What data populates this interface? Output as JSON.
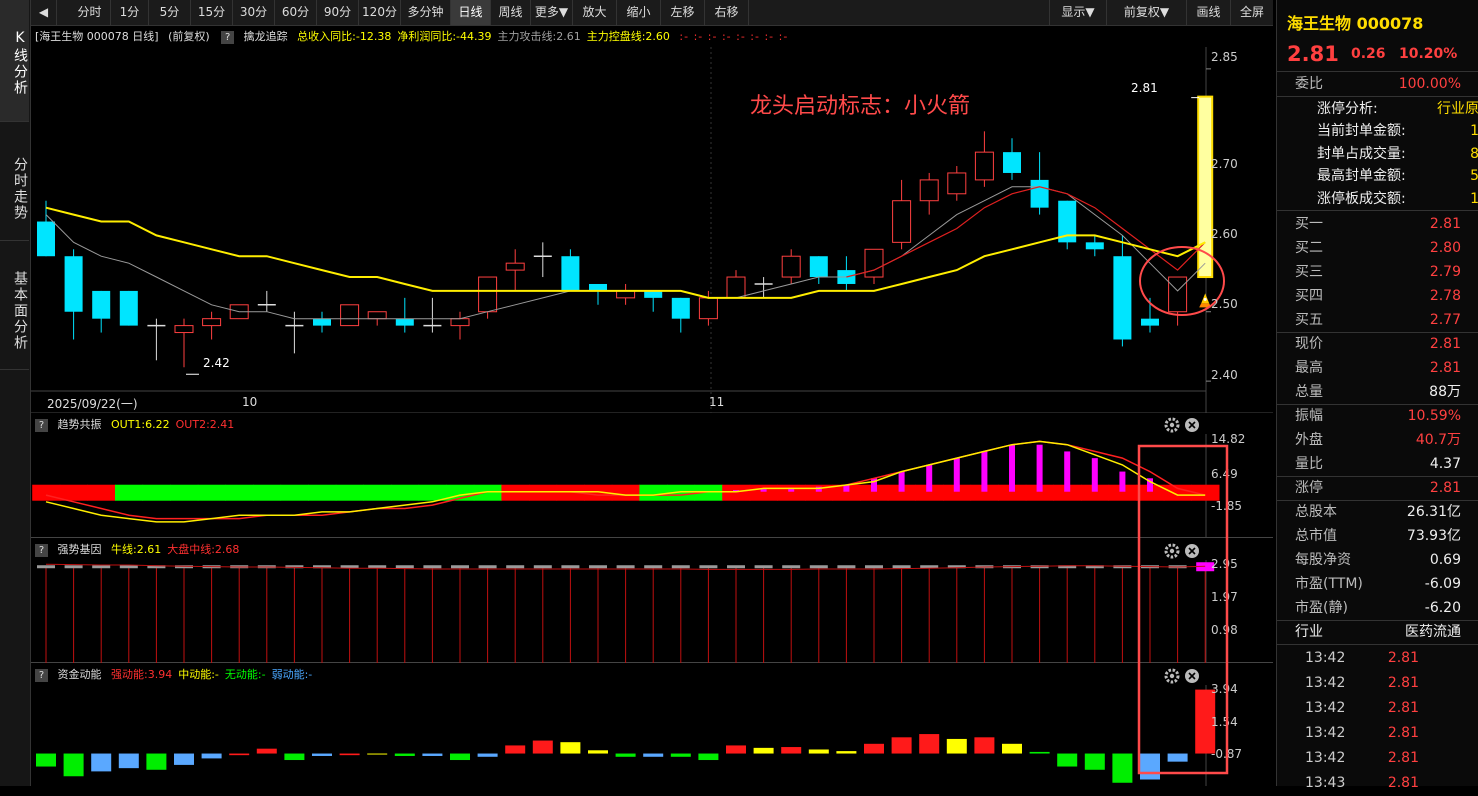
{
  "left_tabs": [
    {
      "label": "K线分析",
      "active": true
    },
    {
      "label": "分时走势",
      "active": false
    },
    {
      "label": "基本面分析",
      "active": false
    }
  ],
  "toolbar": {
    "periods": [
      "分时",
      "1分",
      "5分",
      "15分",
      "30分",
      "60分",
      "90分",
      "120分",
      "多分钟",
      "日线",
      "周线",
      "更多▼"
    ],
    "selected": "日线",
    "actions": [
      "放大",
      "缩小",
      "左移",
      "右移"
    ],
    "right_buttons": [
      "显示▼",
      "前复权▼",
      "画线",
      "全屏"
    ]
  },
  "main_panel": {
    "header_prefix": "[海王生物 000078 日线]",
    "header_adjust": "(前复权)",
    "indicator_name": "擒龙追踪",
    "items": [
      {
        "text": "总收入同比:-12.38",
        "color": "#ffff00"
      },
      {
        "text": "净利润同比:-44.39",
        "color": "#ffff00"
      },
      {
        "text": "主力攻击线:2.61",
        "color": "#a0a0a0"
      },
      {
        "text": "主力控盘线:2.60",
        "color": "#ffff00"
      }
    ],
    "dots": ":- :- :- :- :- :- :- :-",
    "annotation": "龙头启动标志：小火箭",
    "high_label": "2.81",
    "low_label": "2.42",
    "y_ticks": [
      "2.85",
      "2.70",
      "2.60",
      "2.50",
      "2.40"
    ],
    "date_labels": [
      "2025/09/22(一)",
      "10",
      "11"
    ]
  },
  "sub1": {
    "name": "趋势共振",
    "items": [
      {
        "text": "OUT1:6.22",
        "color": "#ffff00"
      },
      {
        "text": "OUT2:2.41",
        "color": "#ff3030"
      }
    ],
    "y_ticks": [
      "14.82",
      "6.49",
      "-1.85"
    ]
  },
  "sub2": {
    "name": "强势基因",
    "items": [
      {
        "text": "牛线:2.61",
        "color": "#ffff00"
      },
      {
        "text": "大盘中线:2.68",
        "color": "#ff3030"
      }
    ],
    "y_ticks": [
      "2.95",
      "1.97",
      "0.98"
    ]
  },
  "sub3": {
    "name": "资金动能",
    "items": [
      {
        "text": "强动能:3.94",
        "color": "#ff3030"
      },
      {
        "text": "中动能:-",
        "color": "#ffff00"
      },
      {
        "text": "无动能:-",
        "color": "#00ff00"
      },
      {
        "text": "弱动能:-",
        "color": "#4aa8ff"
      }
    ],
    "y_ticks": [
      "3.94",
      "1.54",
      "-0.87"
    ]
  },
  "quote": {
    "title": "海王生物 000078",
    "price": "2.81",
    "change": "0.26",
    "pct": "10.20%",
    "webi_label": "委比",
    "webi_value": "100.00%",
    "limit_rows": [
      {
        "label": "涨停分析:",
        "value": "行业原"
      },
      {
        "label": "当前封单金额:",
        "value": "1"
      },
      {
        "label": "封单占成交量:",
        "value": "8"
      },
      {
        "label": "最高封单金额:",
        "value": "5"
      },
      {
        "label": "涨停板成交额:",
        "value": "1"
      }
    ],
    "buy": [
      {
        "label": "买一",
        "value": "2.81"
      },
      {
        "label": "买二",
        "value": "2.80"
      },
      {
        "label": "买三",
        "value": "2.79"
      },
      {
        "label": "买四",
        "value": "2.78"
      },
      {
        "label": "买五",
        "value": "2.77"
      }
    ],
    "stats1": [
      {
        "label": "现价",
        "value": "2.81",
        "color": "#ff4040"
      },
      {
        "label": "最高",
        "value": "2.81",
        "color": "#ff4040"
      },
      {
        "label": "总量",
        "value": "88万",
        "color": "#eeeeee"
      }
    ],
    "stats2": [
      {
        "label": "振幅",
        "value": "10.59%",
        "color": "#ff4040"
      },
      {
        "label": "外盘",
        "value": "40.7万",
        "color": "#ff4040"
      },
      {
        "label": "量比",
        "value": "4.37",
        "color": "#eeeeee"
      }
    ],
    "stats3": [
      {
        "label": "涨停",
        "value": "2.81",
        "color": "#ff4040"
      }
    ],
    "stats4": [
      {
        "label": "总股本",
        "value": "26.31亿",
        "color": "#eeeeee"
      },
      {
        "label": "总市值",
        "value": "73.93亿",
        "color": "#eeeeee"
      },
      {
        "label": "每股净资",
        "value": "0.69",
        "color": "#eeeeee"
      },
      {
        "label": "市盈(TTM)",
        "value": "-6.09",
        "color": "#eeeeee"
      },
      {
        "label": "市盈(静)",
        "value": "-6.20",
        "color": "#eeeeee"
      }
    ],
    "industry_label": "行业",
    "industry_value": "医药流通",
    "ticks": [
      {
        "time": "13:42",
        "price": "2.81"
      },
      {
        "time": "13:42",
        "price": "2.81"
      },
      {
        "time": "13:42",
        "price": "2.81"
      },
      {
        "time": "13:42",
        "price": "2.81"
      },
      {
        "time": "13:42",
        "price": "2.81"
      },
      {
        "time": "13:43",
        "price": "2.81"
      }
    ]
  },
  "chart_data": {
    "type": "candlestick",
    "ylim": [
      2.38,
      2.87
    ],
    "candles": [
      {
        "o": 2.63,
        "h": 2.66,
        "l": 2.58,
        "c": 2.58
      },
      {
        "o": 2.58,
        "h": 2.59,
        "l": 2.46,
        "c": 2.5
      },
      {
        "o": 2.53,
        "h": 2.53,
        "l": 2.47,
        "c": 2.49
      },
      {
        "o": 2.53,
        "h": 2.53,
        "l": 2.48,
        "c": 2.48
      },
      {
        "o": 2.48,
        "h": 2.49,
        "l": 2.43,
        "c": 2.48
      },
      {
        "o": 2.47,
        "h": 2.49,
        "l": 2.42,
        "c": 2.48
      },
      {
        "o": 2.48,
        "h": 2.5,
        "l": 2.46,
        "c": 2.49
      },
      {
        "o": 2.49,
        "h": 2.51,
        "l": 2.49,
        "c": 2.51
      },
      {
        "o": 2.51,
        "h": 2.53,
        "l": 2.5,
        "c": 2.51
      },
      {
        "o": 2.48,
        "h": 2.5,
        "l": 2.44,
        "c": 2.48
      },
      {
        "o": 2.49,
        "h": 2.5,
        "l": 2.47,
        "c": 2.48
      },
      {
        "o": 2.48,
        "h": 2.51,
        "l": 2.48,
        "c": 2.51
      },
      {
        "o": 2.49,
        "h": 2.5,
        "l": 2.48,
        "c": 2.5
      },
      {
        "o": 2.49,
        "h": 2.52,
        "l": 2.47,
        "c": 2.48
      },
      {
        "o": 2.48,
        "h": 2.52,
        "l": 2.47,
        "c": 2.48
      },
      {
        "o": 2.48,
        "h": 2.5,
        "l": 2.46,
        "c": 2.49
      },
      {
        "o": 2.5,
        "h": 2.55,
        "l": 2.49,
        "c": 2.55
      },
      {
        "o": 2.56,
        "h": 2.59,
        "l": 2.53,
        "c": 2.57
      },
      {
        "o": 2.58,
        "h": 2.6,
        "l": 2.55,
        "c": 2.58
      },
      {
        "o": 2.58,
        "h": 2.59,
        "l": 2.53,
        "c": 2.53
      },
      {
        "o": 2.54,
        "h": 2.54,
        "l": 2.51,
        "c": 2.53
      },
      {
        "o": 2.52,
        "h": 2.54,
        "l": 2.51,
        "c": 2.53
      },
      {
        "o": 2.53,
        "h": 2.53,
        "l": 2.5,
        "c": 2.52
      },
      {
        "o": 2.52,
        "h": 2.52,
        "l": 2.47,
        "c": 2.49
      },
      {
        "o": 2.49,
        "h": 2.53,
        "l": 2.48,
        "c": 2.52
      },
      {
        "o": 2.52,
        "h": 2.56,
        "l": 2.52,
        "c": 2.55
      },
      {
        "o": 2.54,
        "h": 2.55,
        "l": 2.52,
        "c": 2.54
      },
      {
        "o": 2.55,
        "h": 2.59,
        "l": 2.54,
        "c": 2.58
      },
      {
        "o": 2.58,
        "h": 2.58,
        "l": 2.54,
        "c": 2.55
      },
      {
        "o": 2.56,
        "h": 2.58,
        "l": 2.53,
        "c": 2.54
      },
      {
        "o": 2.55,
        "h": 2.59,
        "l": 2.54,
        "c": 2.59
      },
      {
        "o": 2.6,
        "h": 2.69,
        "l": 2.59,
        "c": 2.66
      },
      {
        "o": 2.66,
        "h": 2.7,
        "l": 2.64,
        "c": 2.69
      },
      {
        "o": 2.67,
        "h": 2.71,
        "l": 2.66,
        "c": 2.7
      },
      {
        "o": 2.69,
        "h": 2.76,
        "l": 2.68,
        "c": 2.73
      },
      {
        "o": 2.73,
        "h": 2.75,
        "l": 2.69,
        "c": 2.7
      },
      {
        "o": 2.69,
        "h": 2.73,
        "l": 2.64,
        "c": 2.65
      },
      {
        "o": 2.66,
        "h": 2.66,
        "l": 2.59,
        "c": 2.6
      },
      {
        "o": 2.6,
        "h": 2.61,
        "l": 2.58,
        "c": 2.59
      },
      {
        "o": 2.58,
        "h": 2.61,
        "l": 2.45,
        "c": 2.46
      },
      {
        "o": 2.49,
        "h": 2.52,
        "l": 2.47,
        "c": 2.48
      },
      {
        "o": 2.5,
        "h": 2.55,
        "l": 2.48,
        "c": 2.55
      },
      {
        "o": 2.55,
        "h": 2.81,
        "l": 2.55,
        "c": 2.81
      }
    ],
    "ma_yellow": [
      2.65,
      2.64,
      2.63,
      2.63,
      2.61,
      2.6,
      2.59,
      2.58,
      2.58,
      2.57,
      2.56,
      2.55,
      2.55,
      2.54,
      2.53,
      2.53,
      2.53,
      2.53,
      2.53,
      2.53,
      2.53,
      2.53,
      2.53,
      2.53,
      2.52,
      2.52,
      2.52,
      2.52,
      2.53,
      2.53,
      2.53,
      2.54,
      2.55,
      2.56,
      2.58,
      2.59,
      2.6,
      2.61,
      2.61,
      2.6,
      2.59,
      2.58,
      2.6
    ],
    "ma_gray": [
      2.64,
      2.6,
      2.58,
      2.57,
      2.55,
      2.53,
      2.51,
      2.5,
      2.5,
      2.49,
      2.49,
      2.49,
      2.49,
      2.49,
      2.49,
      2.49,
      2.5,
      2.51,
      2.52,
      2.53,
      2.53,
      2.53,
      2.53,
      2.53,
      2.52,
      2.52,
      2.53,
      2.54,
      2.55,
      2.55,
      2.56,
      2.58,
      2.61,
      2.64,
      2.66,
      2.68,
      2.68,
      2.67,
      2.64,
      2.61,
      2.57,
      2.53,
      2.57
    ],
    "ma_red": [
      null,
      null,
      null,
      null,
      null,
      null,
      null,
      null,
      null,
      null,
      null,
      null,
      null,
      null,
      null,
      null,
      null,
      null,
      null,
      null,
      null,
      null,
      null,
      null,
      null,
      null,
      null,
      null,
      null,
      2.55,
      2.56,
      2.58,
      2.6,
      2.62,
      2.65,
      2.67,
      2.68,
      2.67,
      2.65,
      2.62,
      2.59,
      2.56,
      2.6
    ],
    "trend_out1": [
      -3,
      -5,
      -7,
      -8,
      -9,
      -9,
      -8,
      -7,
      -7,
      -7,
      -6,
      -6,
      -5,
      -4,
      -3,
      -1,
      0,
      0,
      0,
      0,
      0,
      -1,
      -1,
      0,
      0,
      0,
      1,
      1,
      1,
      2,
      3,
      6,
      8,
      10,
      12,
      14,
      15,
      14,
      11,
      8,
      3,
      -1,
      -1,
      2,
      6
    ],
    "trend_out2": [
      -1,
      -3,
      -5,
      -7,
      -8,
      -8,
      -8,
      -8,
      -7,
      -7,
      -7,
      -6,
      -5,
      -5,
      -4,
      -2,
      0,
      0,
      0,
      0,
      -1,
      -1,
      -1,
      -1,
      0,
      0,
      1,
      1,
      1,
      2,
      4,
      6,
      8,
      10,
      12,
      14,
      15,
      14,
      12,
      10,
      6,
      1,
      -1,
      -1,
      -1
    ],
    "trend_bars": [
      0,
      0,
      0,
      0,
      0,
      0,
      0,
      0,
      0,
      0,
      0,
      0,
      0,
      0,
      0,
      0,
      0,
      0,
      0,
      0,
      0,
      0,
      0,
      0,
      0,
      0.5,
      1,
      1,
      1.5,
      2,
      4,
      6,
      8,
      10,
      12,
      14,
      14,
      12,
      10,
      6,
      4,
      0,
      0,
      0,
      2,
      6
    ],
    "strong_bars": [
      2.5,
      2.52,
      2.5,
      2.48,
      2.47,
      2.47,
      2.48,
      2.5,
      2.5,
      2.49,
      2.48,
      2.49,
      2.49,
      2.48,
      2.48,
      2.48,
      2.5,
      2.52,
      2.52,
      2.53,
      2.52,
      2.52,
      2.52,
      2.5,
      2.5,
      2.51,
      2.52,
      2.53,
      2.53,
      2.53,
      2.53,
      2.55,
      2.57,
      2.6,
      2.62,
      2.63,
      2.61,
      2.59,
      2.57,
      2.55,
      2.53,
      2.53,
      2.55,
      2.81
    ],
    "money_bars": [
      -0.8,
      -1.4,
      -1.1,
      -0.9,
      -1.0,
      -0.7,
      -0.3,
      -0.1,
      0.3,
      -0.4,
      -0.15,
      -0.1,
      -0.05,
      -0.15,
      -0.15,
      -0.4,
      -0.2,
      0.5,
      0.8,
      0.7,
      0.2,
      -0.2,
      -0.2,
      -0.2,
      -0.4,
      0.5,
      0.35,
      0.4,
      0.25,
      0.15,
      0.6,
      1.0,
      1.2,
      0.9,
      1.0,
      0.6,
      0.1,
      -0.8,
      -1.0,
      -1.8,
      -1.6,
      -0.5,
      3.94
    ],
    "money_colors": [
      "g",
      "g",
      "b",
      "b",
      "g",
      "b",
      "b",
      "r",
      "r",
      "g",
      "b",
      "r",
      "y",
      "g",
      "b",
      "g",
      "b",
      "r",
      "r",
      "y",
      "y",
      "g",
      "b",
      "g",
      "g",
      "r",
      "y",
      "r",
      "y",
      "y",
      "r",
      "r",
      "r",
      "y",
      "r",
      "y",
      "g",
      "g",
      "g",
      "g",
      "b",
      "b",
      "r"
    ]
  }
}
